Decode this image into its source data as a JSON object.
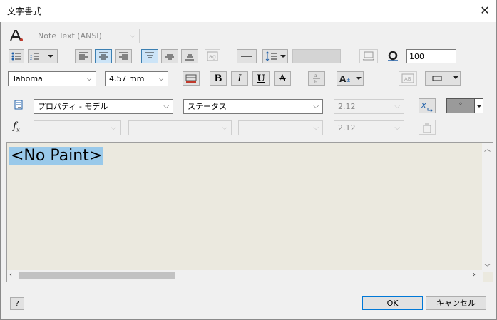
{
  "window": {
    "title": "文字書式",
    "close_glyph": "✕"
  },
  "style": {
    "value": "Note Text (ANSI)"
  },
  "toolbar1": {
    "spacing_value": "100"
  },
  "toolbar2": {
    "font": "Tahoma",
    "size": "4.57 mm",
    "bold": "B",
    "italic": "I",
    "underline": "U",
    "strike": "A"
  },
  "row3": {
    "property_source": "プロパティ - モデル",
    "property": "ステータス",
    "precision": "2.12"
  },
  "row4": {
    "precision": "2.12",
    "fx_label": "fx"
  },
  "editor": {
    "content": "<No Paint>"
  },
  "buttons": {
    "help": "?",
    "ok": "OK",
    "cancel": "キャンセル"
  },
  "colors": {
    "highlight": "#99c9ea",
    "editor_bg": "#ebe9df",
    "selected_btn": "#cce4f7"
  }
}
